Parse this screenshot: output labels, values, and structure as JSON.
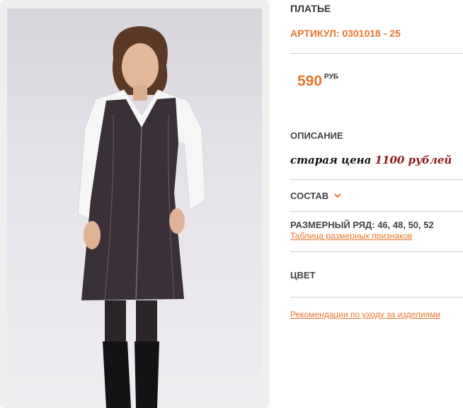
{
  "product": {
    "title": "ПЛАТЬЕ",
    "article": "АРТИКУЛ: 0301018 - 25",
    "price_value": "590",
    "price_currency": "РУБ"
  },
  "description": {
    "label": "ОПИСАНИЕ",
    "old_price_text": "старая цена",
    "old_price_amount": "1100 рублей"
  },
  "composition": {
    "label": "СОСТАВ",
    "icon": "chevron-down-icon"
  },
  "sizes": {
    "label": "РАЗМЕРНЫЙ РЯД: 46, 48, 50, 52",
    "table_link": "Таблица размерных признаков"
  },
  "color": {
    "label": "ЦВЕТ"
  },
  "care": {
    "link": "Рекомендации по уходу за изделиями"
  },
  "colors": {
    "accent": "#e8762b",
    "old_price": "#8b1a1a"
  }
}
